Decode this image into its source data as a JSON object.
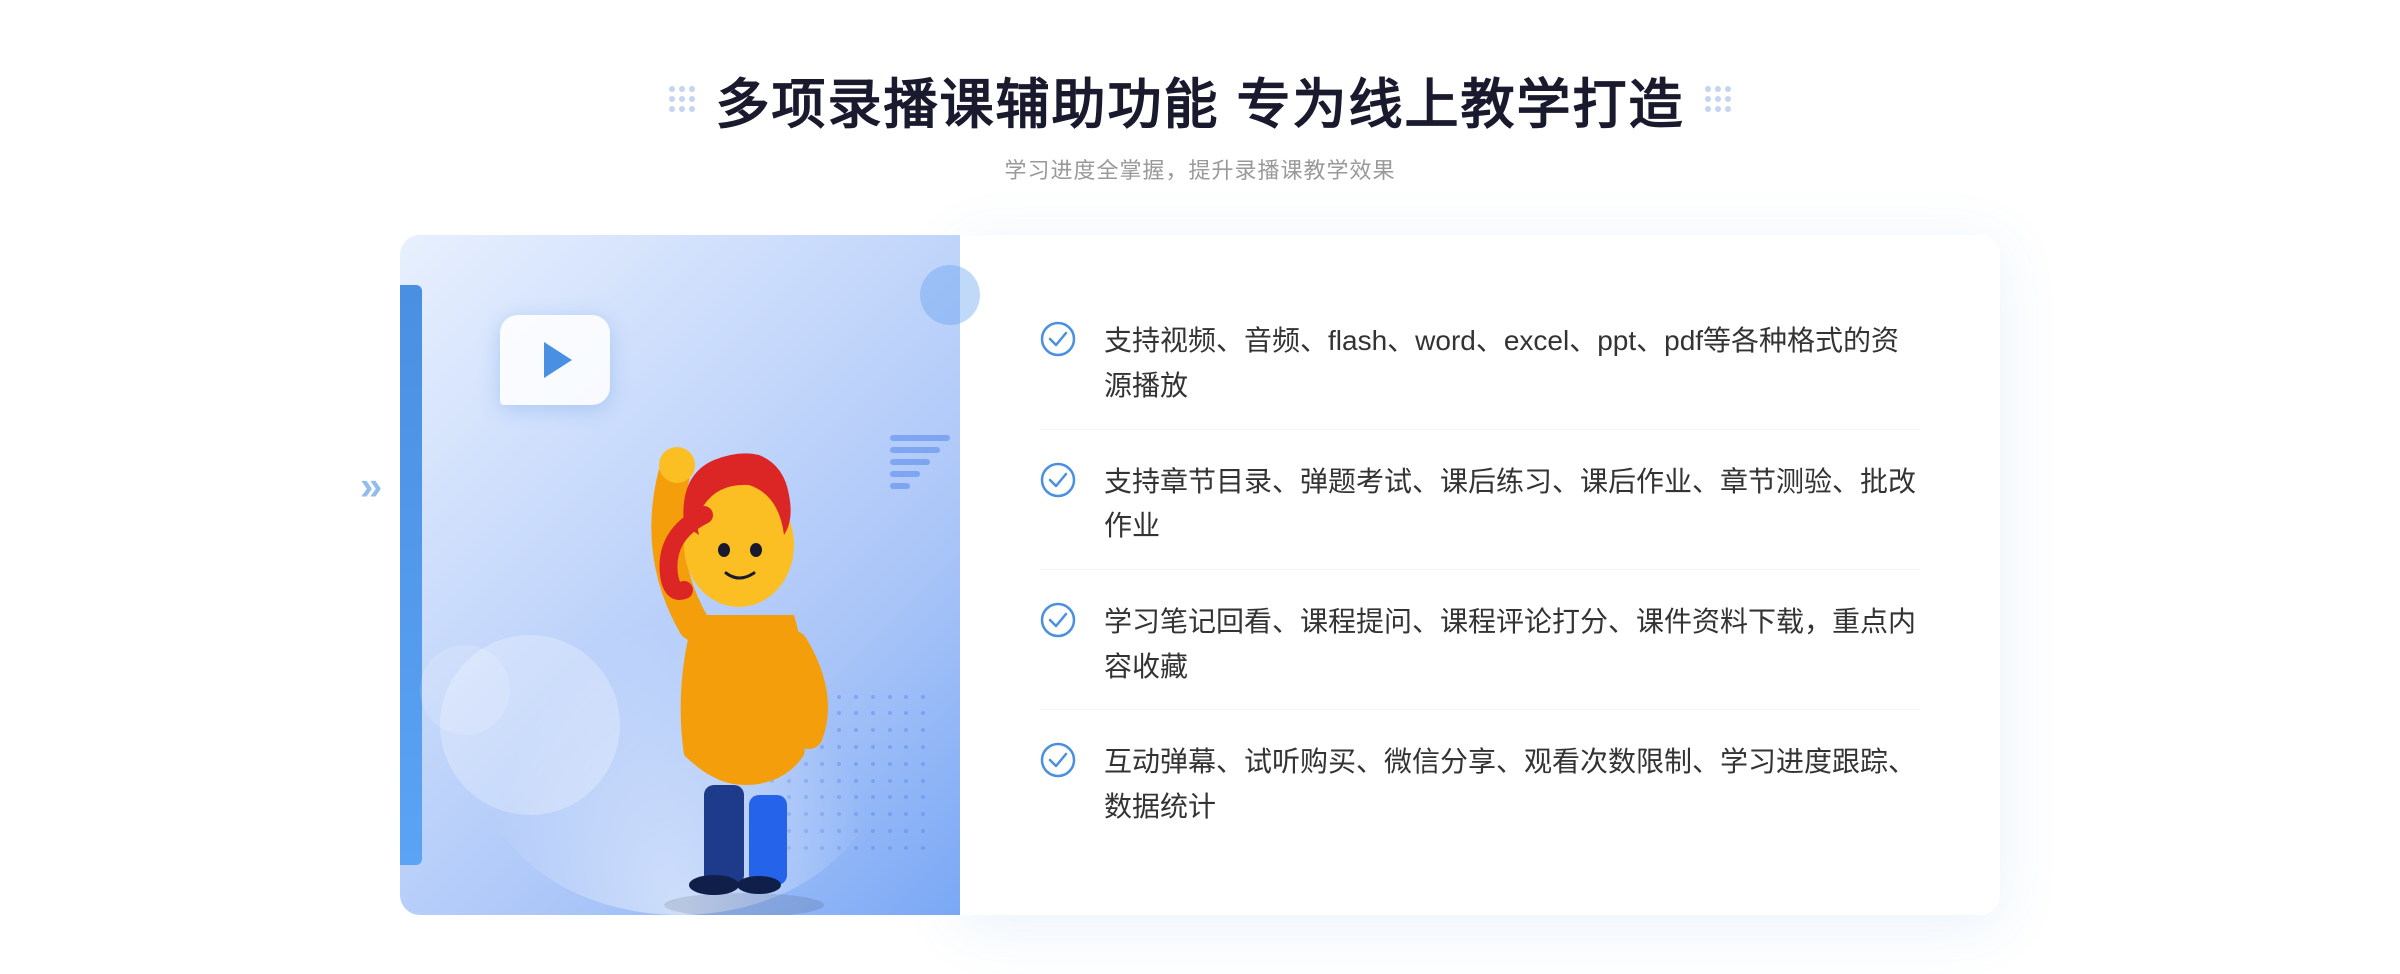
{
  "header": {
    "title": "多项录播课辅助功能 专为线上教学打造",
    "subtitle": "学习进度全掌握，提升录播课教学效果"
  },
  "features": [
    {
      "id": 1,
      "text": "支持视频、音频、flash、word、excel、ppt、pdf等各种格式的资源播放"
    },
    {
      "id": 2,
      "text": "支持章节目录、弹题考试、课后练习、课后作业、章节测验、批改作业"
    },
    {
      "id": 3,
      "text": "学习笔记回看、课程提问、课程评论打分、课件资料下载，重点内容收藏"
    },
    {
      "id": 4,
      "text": "互动弹幕、试听购买、微信分享、观看次数限制、学习进度跟踪、数据统计"
    }
  ],
  "colors": {
    "primary": "#4a90e2",
    "title": "#1a1a2e",
    "subtitle": "#999999",
    "feature_text": "#333333",
    "check_color": "#4a90e2"
  },
  "icons": {
    "check": "check-circle",
    "play": "play-triangle",
    "dots_left": "decorative-dots-left",
    "dots_right": "decorative-dots-right"
  }
}
